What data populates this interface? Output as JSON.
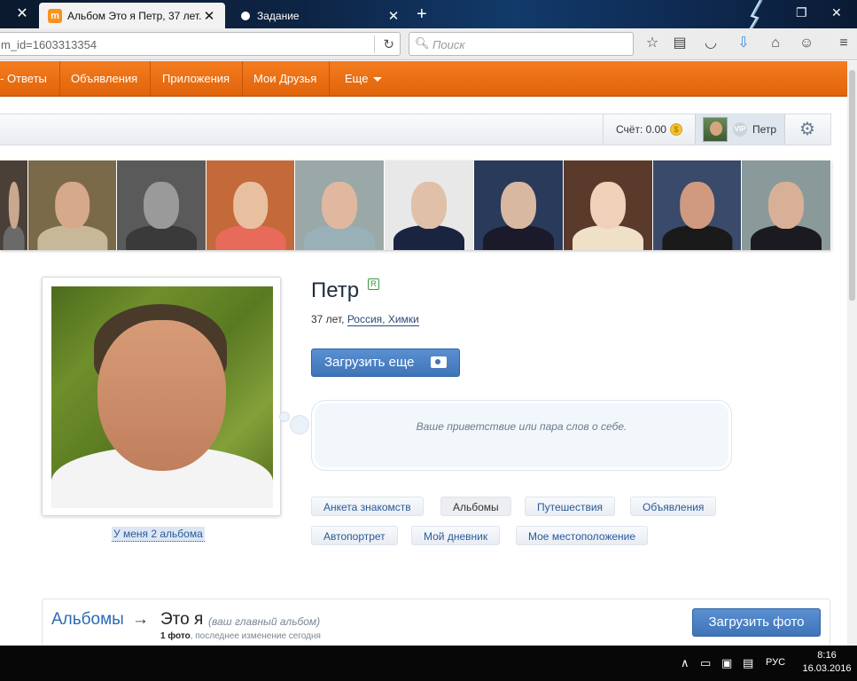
{
  "browser": {
    "tabs": [
      {
        "title": "Альбом Это я Петр, 37 лет...",
        "favicon": "m",
        "active": true
      },
      {
        "title": "Задание",
        "active": false
      }
    ],
    "url": "m_id=1603313354",
    "search_placeholder": "Поиск"
  },
  "menu": {
    "items": [
      "- Ответы",
      "Объявления",
      "Приложения",
      "Мои Друзья",
      "Еще"
    ]
  },
  "account": {
    "score_label": "Счёт: 0.00",
    "coin": "$",
    "vip": "VIP",
    "user_name": "Петр"
  },
  "strip_photos": [
    {
      "bg": "#4a4038",
      "skin": "#c9a890",
      "cloth": "#6a6a6a",
      "w": 32
    },
    {
      "bg": "#7a6a4a",
      "skin": "#d6a98a",
      "cloth": "#c8b89a",
      "w": 100
    },
    {
      "bg": "#5a5a5a",
      "skin": "#9a9a9a",
      "cloth": "#3a3a3a",
      "w": 101
    },
    {
      "bg": "#c46a3a",
      "skin": "#e8c0a0",
      "cloth": "#e86a5a",
      "w": 100
    },
    {
      "bg": "#9aa8a8",
      "skin": "#e0b8a0",
      "cloth": "#9ab0b8",
      "w": 101
    },
    {
      "bg": "#e8e8e8",
      "skin": "#e0c0a8",
      "cloth": "#1a2440",
      "w": 101
    },
    {
      "bg": "#2a3a5a",
      "skin": "#d8b8a0",
      "cloth": "#1a1a2a",
      "w": 101
    },
    {
      "bg": "#5a3a2a",
      "skin": "#f0d0b8",
      "cloth": "#f0e0c8",
      "w": 101
    },
    {
      "bg": "#3a4a6a",
      "skin": "#d09a80",
      "cloth": "#1a1a1a",
      "w": 100
    },
    {
      "bg": "#8a9a9a",
      "skin": "#d8b098",
      "cloth": "#1a1a20",
      "w": 101
    }
  ],
  "profile": {
    "name": "Петр",
    "badge": "R",
    "age": "37 лет,",
    "location": "Россия, Химки",
    "upload_more": "Загрузить еще",
    "greeting_placeholder": "Ваше приветствие или пара слов о себе.",
    "albums_link": "У меня 2 альбома"
  },
  "profile_tabs": [
    {
      "label": "Анкета знакомств",
      "active": false
    },
    {
      "label": "Альбомы",
      "active": true
    },
    {
      "label": "Путешествия",
      "active": false
    },
    {
      "label": "Объявления",
      "active": false
    },
    {
      "label": "Автопортрет",
      "active": false
    },
    {
      "label": "Мой дневник",
      "active": false
    },
    {
      "label": "Мое местоположение",
      "active": false
    }
  ],
  "albums_panel": {
    "title": "Альбомы",
    "arrow": "→",
    "album_name": "Это я",
    "album_note": "(ваш главный альбом)",
    "count": "1 фото",
    "meta": ", последнее изменение сегодня",
    "upload_photo": "Загрузить фото"
  },
  "taskbar": {
    "lang": "РУС",
    "time": "8:16",
    "date": "16.03.2016"
  },
  "colors": {
    "accent_orange": "#e86e14",
    "link_blue": "#2a6ab5",
    "button_blue": "#4a80c4"
  }
}
